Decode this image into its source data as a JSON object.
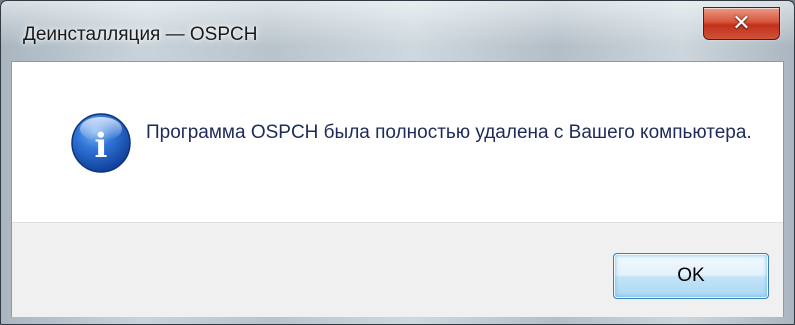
{
  "window": {
    "title": "Деинсталляция — OSPCH",
    "close_icon": "close-icon",
    "close_glyph": "✕"
  },
  "message": {
    "icon": "info-icon",
    "icon_glyph": "i",
    "text": "Программа OSPCH была полностью удалена с Вашего компьютера."
  },
  "footer": {
    "ok_label": "OK"
  },
  "colors": {
    "close_button": "#c7391f",
    "info_icon": "#1f5fc2",
    "ok_border": "#3c7fb1",
    "message_text": "#1e2a5a"
  }
}
